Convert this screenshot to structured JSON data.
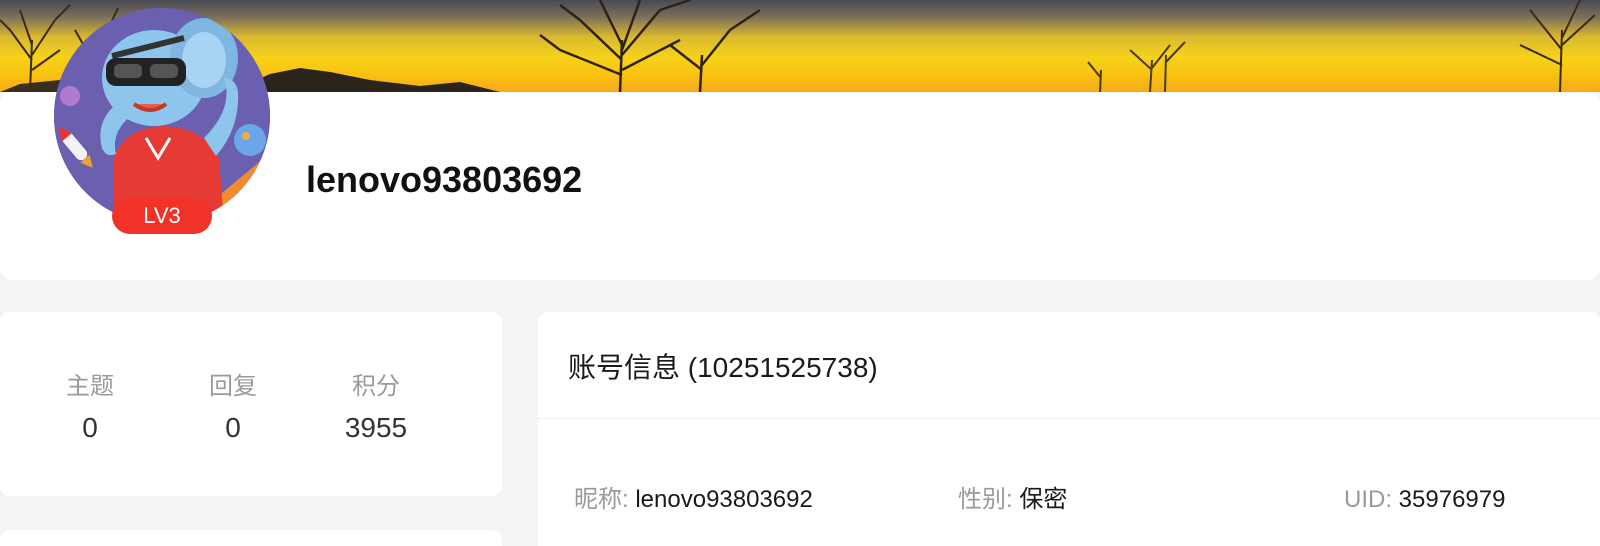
{
  "profile": {
    "username": "lenovo93803692",
    "level": "LV3"
  },
  "stats": [
    {
      "label": "主题",
      "value": "0"
    },
    {
      "label": "回复",
      "value": "0"
    },
    {
      "label": "积分",
      "value": "3955"
    }
  ],
  "account": {
    "title": "账号信息 (10251525738)",
    "nickname_label": "昵称:",
    "nickname_value": "lenovo93803692",
    "gender_label": "性别:",
    "gender_value": "保密",
    "uid_label": "UID:",
    "uid_value": "35976979"
  },
  "colors": {
    "level_badge": "#f03228",
    "page_background": "#f4f4f4",
    "banner_yellow": "#f6d21a"
  }
}
